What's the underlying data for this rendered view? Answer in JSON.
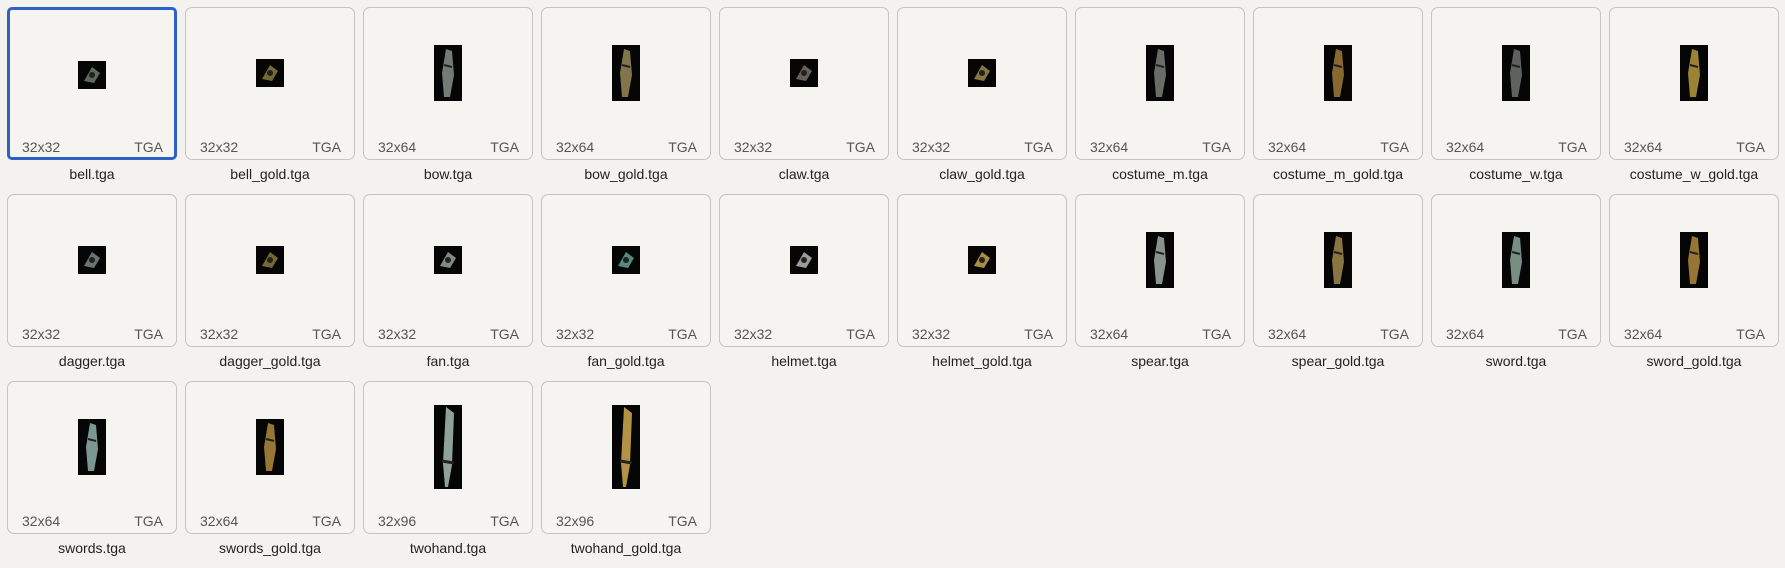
{
  "files": [
    {
      "name": "bell.tga",
      "dims": "32x32",
      "ext": "TGA",
      "icon": "bell-icon",
      "art": "#6f7a6c",
      "selected": true
    },
    {
      "name": "bell_gold.tga",
      "dims": "32x32",
      "ext": "TGA",
      "icon": "bell-icon",
      "art": "#8a7b3c"
    },
    {
      "name": "bow.tga",
      "dims": "32x64",
      "ext": "TGA",
      "icon": "bow-icon",
      "art": "#8b8f8c"
    },
    {
      "name": "bow_gold.tga",
      "dims": "32x64",
      "ext": "TGA",
      "icon": "bow-icon",
      "art": "#9a8a58"
    },
    {
      "name": "claw.tga",
      "dims": "32x32",
      "ext": "TGA",
      "icon": "claw-icon",
      "art": "#7a6f6a"
    },
    {
      "name": "claw_gold.tga",
      "dims": "32x32",
      "ext": "TGA",
      "icon": "claw-icon",
      "art": "#9a8a50"
    },
    {
      "name": "costume_m.tga",
      "dims": "32x64",
      "ext": "TGA",
      "icon": "costume-icon",
      "art": "#7d7f7a"
    },
    {
      "name": "costume_m_gold.tga",
      "dims": "32x64",
      "ext": "TGA",
      "icon": "costume-icon",
      "art": "#a07a3a"
    },
    {
      "name": "costume_w.tga",
      "dims": "32x64",
      "ext": "TGA",
      "icon": "costume-icon",
      "art": "#6f726e"
    },
    {
      "name": "costume_w_gold.tga",
      "dims": "32x64",
      "ext": "TGA",
      "icon": "costume-icon",
      "art": "#b59a3c"
    },
    {
      "name": "dagger.tga",
      "dims": "32x32",
      "ext": "TGA",
      "icon": "dagger-icon",
      "art": "#7e8a83"
    },
    {
      "name": "dagger_gold.tga",
      "dims": "32x32",
      "ext": "TGA",
      "icon": "dagger-icon",
      "art": "#8a7b3c"
    },
    {
      "name": "fan.tga",
      "dims": "32x32",
      "ext": "TGA",
      "icon": "fan-icon",
      "art": "#9aa19a"
    },
    {
      "name": "fan_gold.tga",
      "dims": "32x32",
      "ext": "TGA",
      "icon": "fan-icon",
      "art": "#5ea493"
    },
    {
      "name": "helmet.tga",
      "dims": "32x32",
      "ext": "TGA",
      "icon": "helmet-icon",
      "art": "#b7b7b4"
    },
    {
      "name": "helmet_gold.tga",
      "dims": "32x32",
      "ext": "TGA",
      "icon": "helmet-icon",
      "art": "#c7a64c"
    },
    {
      "name": "spear.tga",
      "dims": "32x64",
      "ext": "TGA",
      "icon": "spear-icon",
      "art": "#a2aca7"
    },
    {
      "name": "spear_gold.tga",
      "dims": "32x64",
      "ext": "TGA",
      "icon": "spear-icon",
      "art": "#a08a4e"
    },
    {
      "name": "sword.tga",
      "dims": "32x64",
      "ext": "TGA",
      "icon": "sword-icon",
      "art": "#8ea79a"
    },
    {
      "name": "sword_gold.tga",
      "dims": "32x64",
      "ext": "TGA",
      "icon": "sword-icon",
      "art": "#b08a3e"
    },
    {
      "name": "swords.tga",
      "dims": "32x64",
      "ext": "TGA",
      "icon": "swords-icon",
      "art": "#8fb3a8"
    },
    {
      "name": "swords_gold.tga",
      "dims": "32x64",
      "ext": "TGA",
      "icon": "swords-icon",
      "art": "#b08a3e"
    },
    {
      "name": "twohand.tga",
      "dims": "32x96",
      "ext": "TGA",
      "icon": "twohand-icon",
      "art": "#9fb4ab"
    },
    {
      "name": "twohand_gold.tga",
      "dims": "32x96",
      "ext": "TGA",
      "icon": "twohand-icon",
      "art": "#c6a24c"
    }
  ],
  "colors": {
    "selection_border": "#2b62c3",
    "tile_border": "#c6c4bf",
    "tile_bg": "#f5f4f1",
    "page_bg": "#f3f2ee"
  }
}
